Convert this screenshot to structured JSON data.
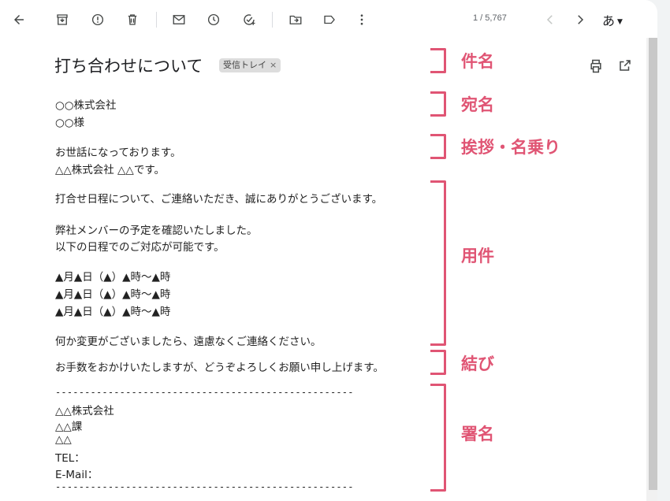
{
  "toolbar": {
    "pager": "1 / 5,767",
    "input_tool": "あ"
  },
  "email": {
    "subject": "打ち合わせについて",
    "label": "受信トレイ",
    "label_close": "×",
    "recipient": [
      "○○株式会社",
      "○○様"
    ],
    "greeting": [
      "お世話になっております。",
      "△△株式会社 △△です。"
    ],
    "business": [
      "打合せ日程について、ご連絡いただき、誠にありがとうございます。",
      "弊社メンバーの予定を確認いたしました。",
      "以下の日程でのご対応が可能です。",
      "▲月▲日（▲）▲時～▲時",
      "▲月▲日（▲）▲時～▲時",
      "▲月▲日（▲）▲時～▲時",
      "何か変更がございましたら、遠慮なくご連絡ください。"
    ],
    "closing": "お手数をおかけいたしますが、どうぞよろしくお願い申し上げます。",
    "signature": {
      "divider": "---------------------------------------------------",
      "company": "△△株式会社",
      "dept": "△△課",
      "name": "△△",
      "tel": "TEL：",
      "email": "E-Mail："
    }
  },
  "annotations": {
    "subject": "件名",
    "recipient": "宛名",
    "greeting": "挨拶・名乗り",
    "business": "用件",
    "closing": "結び",
    "signature": "署名"
  },
  "colors": {
    "annotation": "#e05574"
  }
}
